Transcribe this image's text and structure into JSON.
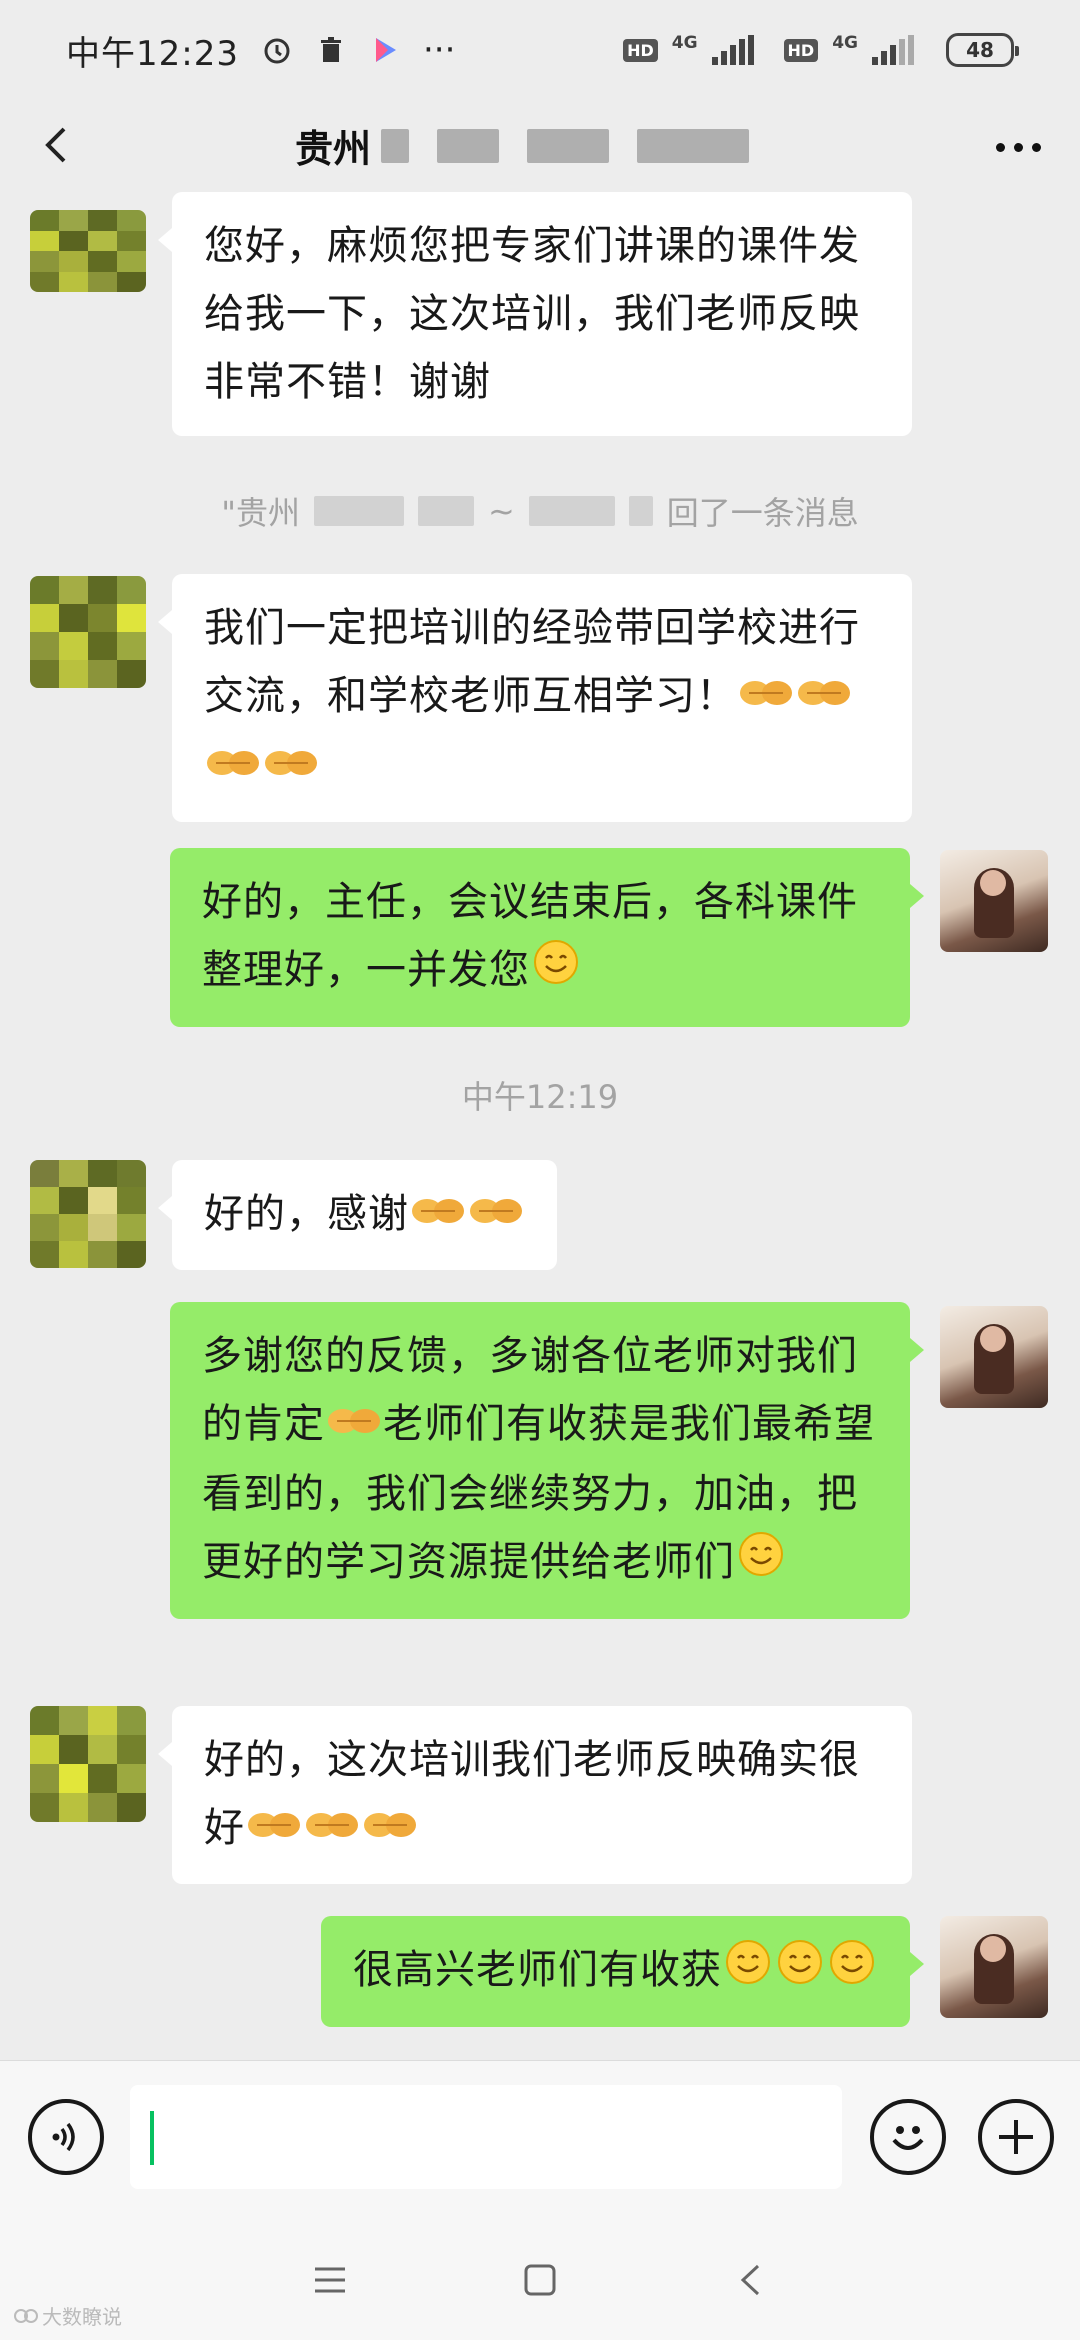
{
  "status_bar": {
    "time": "中午12:23",
    "more": "···",
    "hd1": "HD",
    "net1": "4G",
    "hd2": "HD",
    "net2": "4G",
    "battery": "48"
  },
  "header": {
    "title_visible": "贵州",
    "back_icon": "chevron-left-icon",
    "more_icon": "more-dots-icon"
  },
  "messages": [
    {
      "side": "in",
      "text": "您好，麻烦您把专家们讲课的课件发给我一下，这次培训，我们老师反映非常不错！谢谢",
      "emojis": []
    },
    {
      "side": "in",
      "text": "我们一定把培训的经验带回学校进行交流，和学校老师互相学习！",
      "emojis": [
        "handshake",
        "handshake",
        "handshake",
        "handshake"
      ]
    },
    {
      "side": "out",
      "text": "好的，主任，会议结束后，各科课件整理好，一并发您",
      "emojis": [
        "smile"
      ]
    },
    {
      "side": "in",
      "text": "好的，感谢",
      "emojis": [
        "handshake",
        "handshake"
      ]
    },
    {
      "side": "out",
      "text_part1": "多谢您的反馈，多谢各位老师对我们的肯定",
      "text_part2": "老师们有收获是我们最希望看到的，我们会继续努力，加油，把更好的学习资源提供给老师们",
      "emojis": [
        "handshake",
        "smile"
      ]
    },
    {
      "side": "in",
      "text": "好的，这次培训我们老师反映确实很好",
      "emojis": [
        "handshake",
        "handshake",
        "handshake"
      ]
    },
    {
      "side": "out",
      "text": "很高兴老师们有收获",
      "emojis": [
        "smile",
        "smile",
        "smile"
      ]
    }
  ],
  "system": {
    "recall_prefix": "\"贵州",
    "recall_suffix": "回了一条消息",
    "timestamp": "中午12:19"
  },
  "input_bar": {
    "voice_icon": "voice-icon",
    "emoji_icon": "emoji-icon",
    "plus_icon": "plus-icon",
    "accent_color": "#07c160"
  },
  "colors": {
    "incoming_bubble": "#ffffff",
    "outgoing_bubble": "#95ec69",
    "background": "#ededed"
  },
  "watermark": "大数瞭说"
}
